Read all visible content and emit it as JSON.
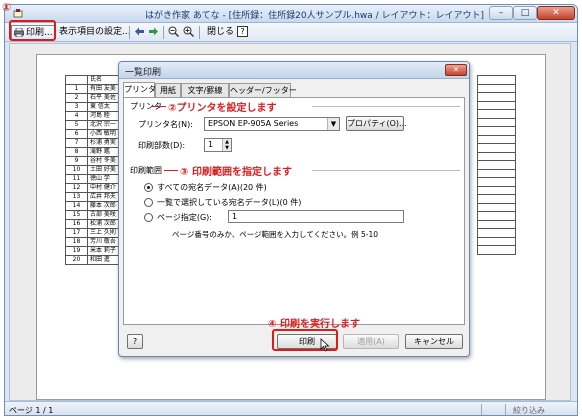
{
  "window": {
    "title": "はがき作家 あてな - [住所録：住所録20人サンプル.hwa / レイアウト：レイアウト]",
    "minimize_glyph": "–",
    "maximize_glyph": "□",
    "close_glyph": "✕"
  },
  "toolbar": {
    "print_label": "印刷...",
    "settings_label": "表示項目の設定...",
    "close_label": "閉じる",
    "help_label": "?"
  },
  "annotations": {
    "step1": "①",
    "step2": "②プリンタを設定します",
    "step3": "③ 印刷範囲を指定します",
    "step4": "④ 印刷を実行します"
  },
  "sheet": {
    "header": "氏名",
    "rows": [
      {
        "num": "1",
        "name": "有田 友美"
      },
      {
        "num": "2",
        "name": "石平 美佐"
      },
      {
        "num": "3",
        "name": "東 信太"
      },
      {
        "num": "4",
        "name": "河島 睦"
      },
      {
        "num": "5",
        "name": "北沢 宗一"
      },
      {
        "num": "6",
        "name": "小西 敏明"
      },
      {
        "num": "7",
        "name": "杉浦 勇実"
      },
      {
        "num": "8",
        "name": "滝野 鑑"
      },
      {
        "num": "9",
        "name": "谷村 冬美"
      },
      {
        "num": "10",
        "name": "土田 好美"
      },
      {
        "num": "11",
        "name": "徳山 学"
      },
      {
        "num": "12",
        "name": "中村 健介"
      },
      {
        "num": "13",
        "name": "広井 邦夫"
      },
      {
        "num": "14",
        "name": "藤本 次郎"
      },
      {
        "num": "15",
        "name": "古部 美咲"
      },
      {
        "num": "16",
        "name": "松浦 次郎"
      },
      {
        "num": "17",
        "name": "三上 久則"
      },
      {
        "num": "18",
        "name": "芳川 敬吾"
      },
      {
        "num": "19",
        "name": "米本 莉子"
      },
      {
        "num": "20",
        "name": "和田 進"
      }
    ]
  },
  "dialog": {
    "title": "一覧印刷",
    "close_glyph": "✕",
    "tabs": [
      "プリンタ",
      "用紙",
      "文字/罫線",
      "ヘッダー/フッター"
    ],
    "printer_group": "プリンタ",
    "printer_name_label": "プリンタ名(N):",
    "printer_name_value": "EPSON EP-905A Series",
    "properties_button": "プロパティ(O)...",
    "copies_label": "印刷部数(D):",
    "copies_value": "1",
    "range_group": "印刷範囲",
    "range_options": [
      "すべての宛名データ(A)(20 件)",
      "一覧で選択している宛名データ(L)(0 件)",
      "ページ指定(G):"
    ],
    "page_input_value": "1",
    "hint": "ページ番号のみか、ページ範囲を入力してください。例 5-10",
    "help_button": "?",
    "print_button": "印刷",
    "apply_button": "適用(A)",
    "cancel_button": "キャンセル"
  },
  "statusbar": {
    "page": "ページ 1 / 1",
    "filter": "絞り込み"
  },
  "colors": {
    "annotation_red": "#d81e1e",
    "titlebar": "#c8d9ee"
  }
}
